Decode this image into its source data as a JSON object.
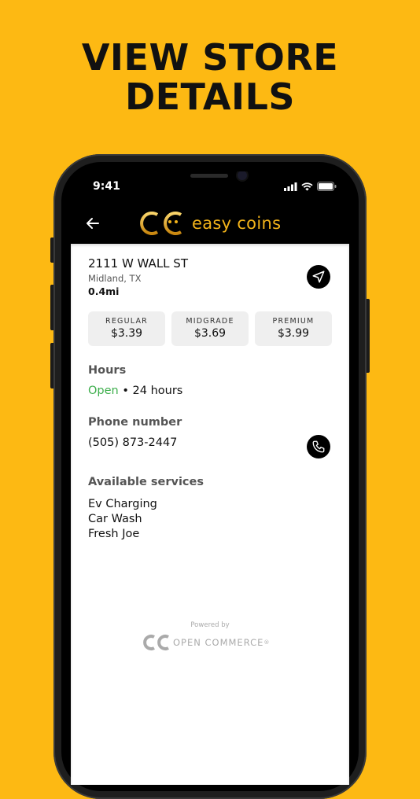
{
  "headline": [
    "VIEW STORE",
    "DETAILS"
  ],
  "status_bar": {
    "time": "9:41"
  },
  "app": {
    "brand": "easy coins"
  },
  "store": {
    "address": "2111 W WALL ST",
    "city": "Midland, TX",
    "distance": "0.4mi"
  },
  "prices": [
    {
      "label": "REGULAR",
      "value": "$3.39"
    },
    {
      "label": "MIDGRADE",
      "value": "$3.69"
    },
    {
      "label": "PREMIUM",
      "value": "$3.99"
    }
  ],
  "hours": {
    "heading": "Hours",
    "status": "Open",
    "detail": " • 24 hours"
  },
  "phone": {
    "heading": "Phone number",
    "number": "(505) 873-2447"
  },
  "services": {
    "heading": "Available services",
    "items": [
      "Ev Charging",
      "Car Wash",
      "Fresh Joe"
    ]
  },
  "footer": {
    "powered_by": "Powered by",
    "brand": "OPEN COMMERCE",
    "mark": "®"
  },
  "colors": {
    "background": "#FDB913",
    "brand_gold": "#F4B41A",
    "open_green": "#3DAE4C"
  }
}
